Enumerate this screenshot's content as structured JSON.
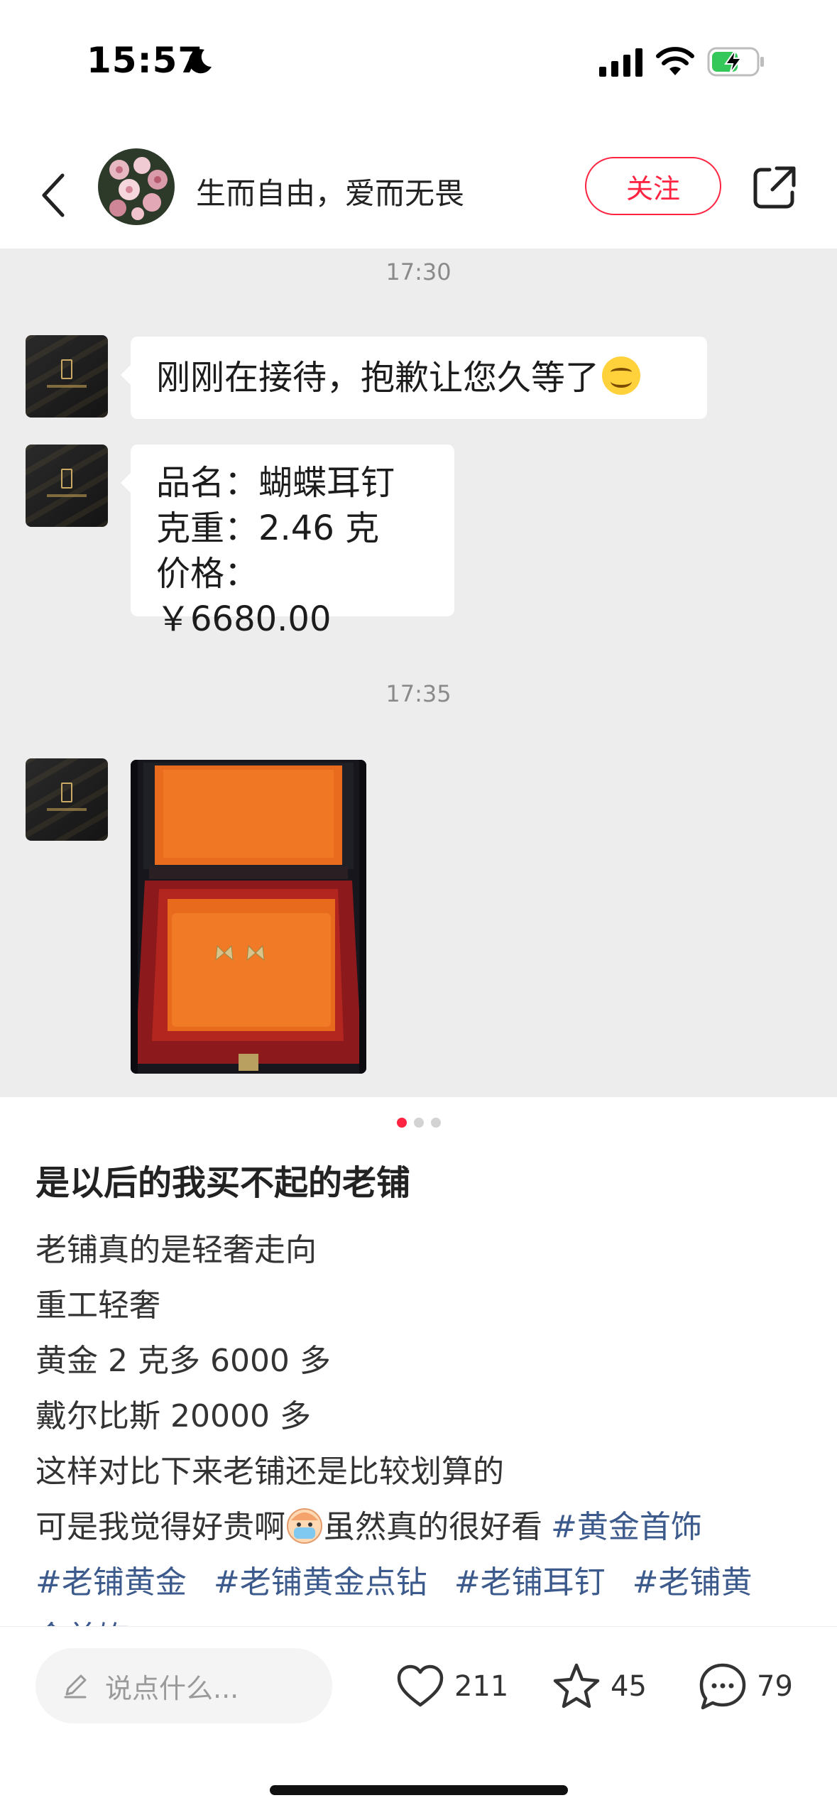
{
  "status_bar": {
    "time": "15:57",
    "icons": [
      "moon-icon",
      "cellular-signal-icon",
      "wifi-icon",
      "battery-charging-icon"
    ]
  },
  "header": {
    "author_name": "生而自由，爱而无畏",
    "follow_label": "关注",
    "icons": [
      "back-icon",
      "share-icon"
    ]
  },
  "image": {
    "chat": {
      "timestamp_1": "17:30",
      "message_1": "刚刚在接待，抱歉让您久等了",
      "message_2_lines": [
        "品名：蝴蝶耳钉",
        "克重：2.46 克",
        "价格：￥6680.00"
      ],
      "timestamp_2": "17:35"
    },
    "pager": {
      "count": 3,
      "active_index": 0
    }
  },
  "post": {
    "title": "是以后的我买不起的老铺",
    "lines": [
      "老铺真的是轻奢走向",
      "重工轻奢",
      "黄金 2 克多 6000 多",
      "戴尔比斯 20000 多",
      "这样对比下来老铺还是比较划算的"
    ],
    "line6_part1": "可是我觉得好贵啊",
    "line6_part2": "虽然真的很好看",
    "tags": [
      "#黄金首饰",
      "#老铺黄金",
      "#老铺黄金点钻",
      "#老铺耳钉",
      "#老铺黄",
      "金首饰"
    ]
  },
  "bottom_bar": {
    "comment_placeholder": "说点什么...",
    "likes": "211",
    "collects": "45",
    "comments": "79"
  },
  "colors": {
    "accent": "#ff2442",
    "tag": "#3c5a8c",
    "chat_bg": "#ededed"
  }
}
